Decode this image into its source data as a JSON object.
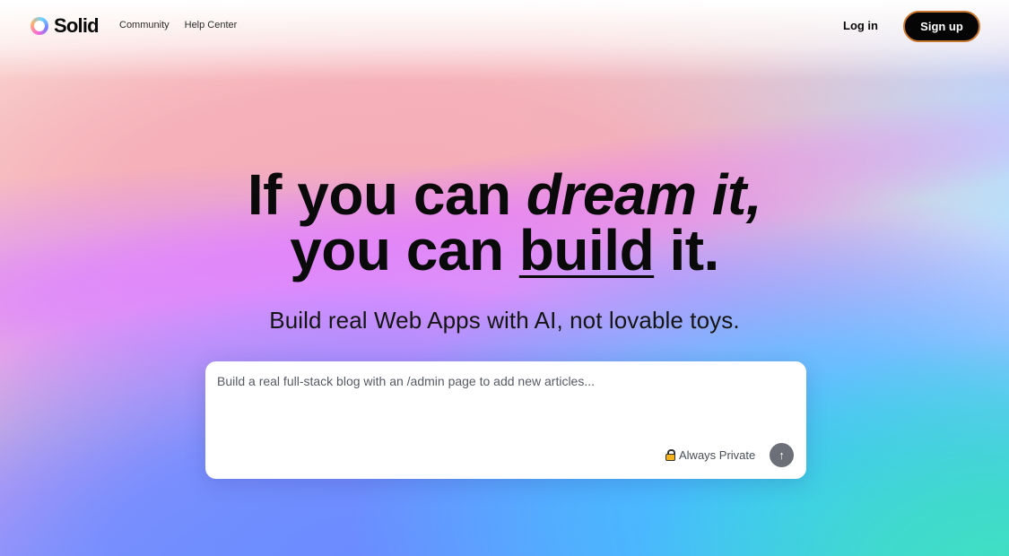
{
  "header": {
    "logo_text": "Solid",
    "nav": [
      {
        "label": "Community"
      },
      {
        "label": "Help Center"
      }
    ],
    "login_label": "Log in",
    "signup_label": "Sign up"
  },
  "hero": {
    "line1_prefix": "If you can ",
    "line1_italic": "dream it,",
    "line2_prefix": "you can ",
    "line2_underlined": "build",
    "line2_suffix": " it.",
    "subheadline": "Build real Web Apps with AI, not lovable toys."
  },
  "prompt": {
    "placeholder": "Build a real full-stack blog with an /admin page to add new articles...",
    "privacy_label": "Always Private",
    "privacy_icon": "lock-icon",
    "send_icon": "arrow-up-icon",
    "send_glyph": "↑"
  },
  "colors": {
    "signup_bg": "#050505",
    "signup_border": "#c9772f",
    "send_bg": "#6d6f78"
  }
}
